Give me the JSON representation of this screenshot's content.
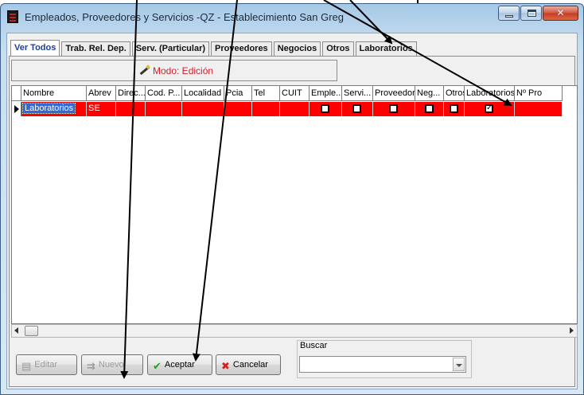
{
  "window": {
    "title": "Empleados, Proveedores y Servicios -QZ - Establecimiento San Greg",
    "controls": [
      "minimize",
      "maximize",
      "close"
    ]
  },
  "tabs": [
    {
      "label": "Ver Todos",
      "active": true
    },
    {
      "label": "Trab. Rel. Dep.",
      "active": false
    },
    {
      "label": "Serv. (Particular)",
      "active": false
    },
    {
      "label": "Proveedores",
      "active": false
    },
    {
      "label": "Negocios",
      "active": false
    },
    {
      "label": "Otros",
      "active": false
    },
    {
      "label": "Laboratorios",
      "active": false
    }
  ],
  "mode": {
    "label": "Modo: Edición",
    "icon": "pencil-icon",
    "color": "#d0202a"
  },
  "grid": {
    "columns": [
      "Nombre",
      "Abrev",
      "Direc...",
      "Cod. P...",
      "Localidad",
      "Pcia",
      "Tel",
      "CUIT",
      "Emple...",
      "Servi...",
      "Proveedor",
      "Neg...",
      "Otros",
      "Laboratorios",
      "Nº Pro"
    ],
    "rows": [
      {
        "nombre": "Laboratorios",
        "abrev": "SE",
        "direc": "",
        "cod": "",
        "localidad": "",
        "pcia": "",
        "tel": "",
        "cuit": "",
        "empleado": false,
        "servicio": false,
        "proveedor": false,
        "negocio": false,
        "otros": false,
        "laboratorios": true,
        "nro": "",
        "row_color": "#ff0000"
      }
    ]
  },
  "buttons": {
    "edit": "Editar",
    "new": "Nuevo",
    "accept": "Aceptar",
    "cancel": "Cancelar"
  },
  "search": {
    "label": "Buscar",
    "value": ""
  }
}
